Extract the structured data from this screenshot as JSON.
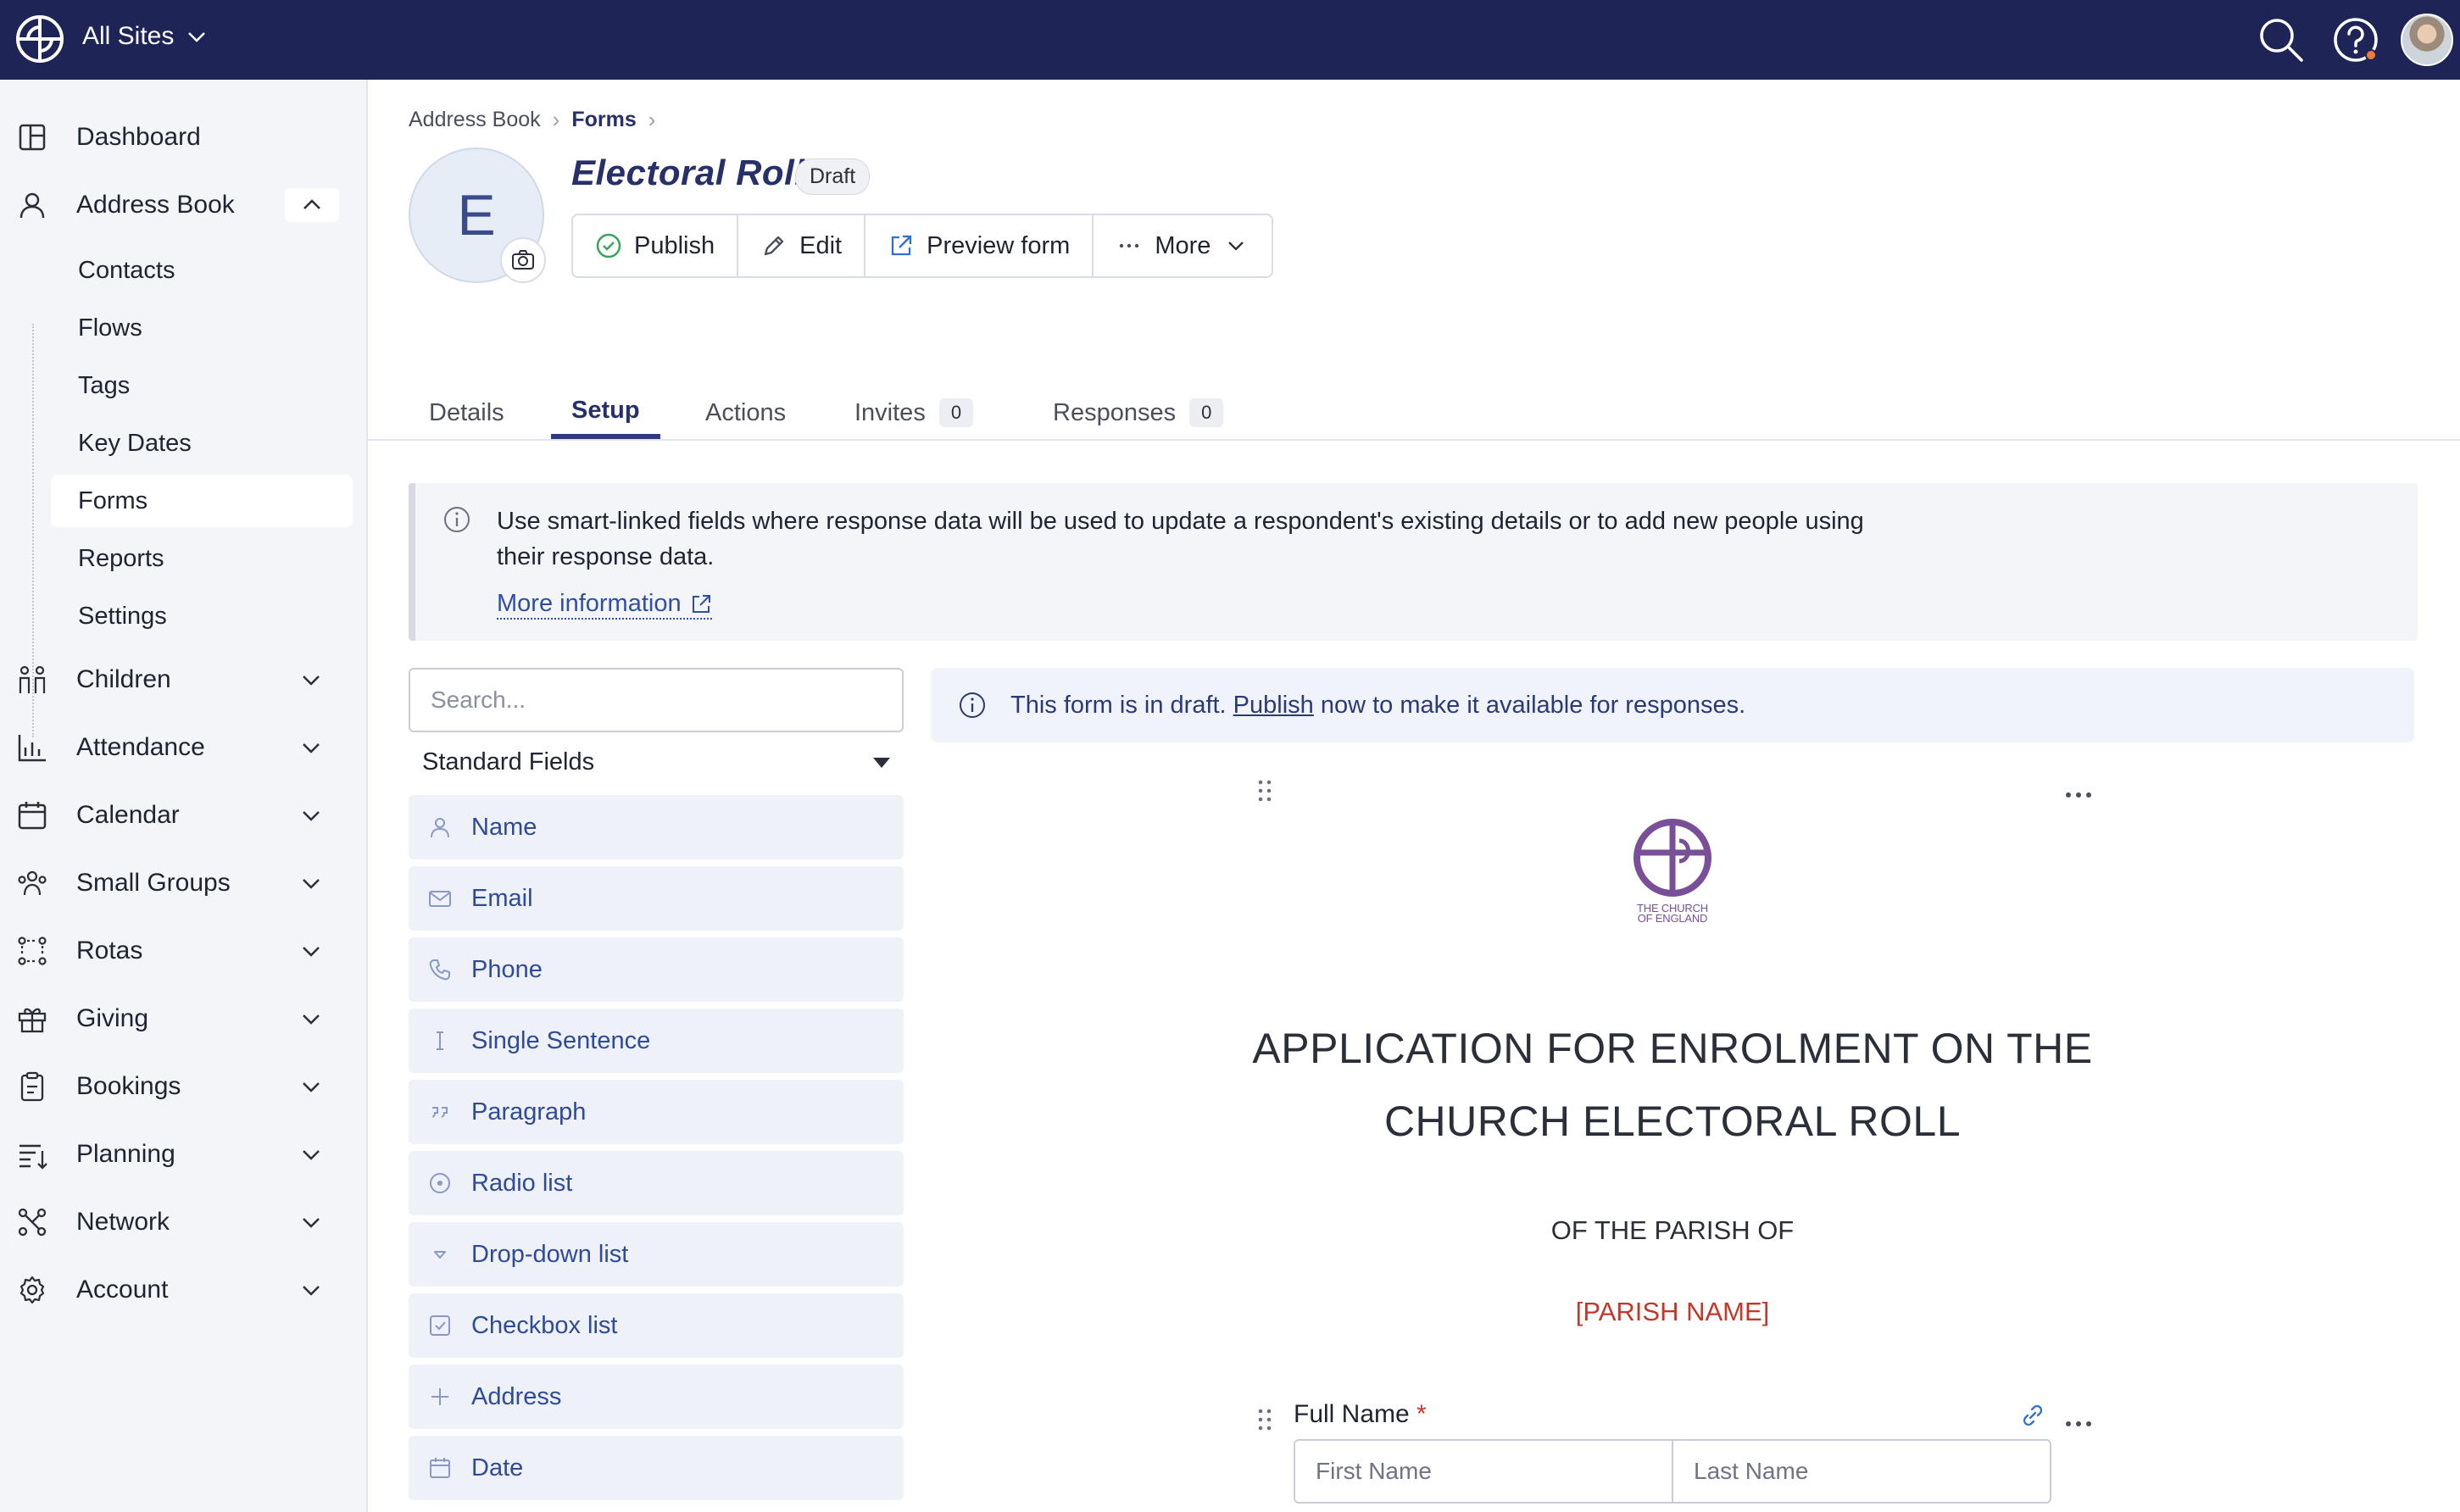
{
  "topbar": {
    "site_label": "All Sites",
    "brand_color": "#1e2456"
  },
  "sidebar": {
    "dashboard": "Dashboard",
    "address_book": "Address Book",
    "sub_items": [
      "Contacts",
      "Flows",
      "Tags",
      "Key Dates",
      "Forms",
      "Reports",
      "Settings"
    ],
    "active_sub_item": "Forms",
    "groups": [
      "Children",
      "Attendance",
      "Calendar",
      "Small Groups",
      "Rotas",
      "Giving",
      "Bookings",
      "Planning",
      "Network",
      "Account"
    ]
  },
  "breadcrumb": {
    "first": "Address Book",
    "second": "Forms"
  },
  "form": {
    "avatar_letter": "E",
    "title": "Electoral Roll",
    "status": "Draft"
  },
  "actions": {
    "publish": "Publish",
    "edit": "Edit",
    "preview": "Preview form",
    "more": "More"
  },
  "tabs": {
    "details": "Details",
    "setup": "Setup",
    "actions": "Actions",
    "invites": "Invites",
    "invites_count": "0",
    "responses": "Responses",
    "responses_count": "0",
    "active": "Setup"
  },
  "info": {
    "text": "Use smart-linked fields where response data will be used to update a respondent's existing details or to add new people using their response data.",
    "link": "More information"
  },
  "palette": {
    "search_placeholder": "Search...",
    "category": "Standard Fields",
    "fields": [
      "Name",
      "Email",
      "Phone",
      "Single Sentence",
      "Paragraph",
      "Radio list",
      "Drop-down list",
      "Checkbox list",
      "Address",
      "Date"
    ]
  },
  "preview": {
    "draft_note_before": "This form is in draft. ",
    "draft_note_link": "Publish",
    "draft_note_after": " now to make it available for responses.",
    "logo_line1": "THE CHURCH",
    "logo_line2": "OF ENGLAND",
    "heading_line1": "APPLICATION FOR ENROLMENT ON THE",
    "heading_line2": "CHURCH ELECTORAL ROLL",
    "sub_heading": "OF THE PARISH OF",
    "parish_placeholder": "[PARISH NAME]",
    "parish_color": "#c0392b",
    "field_label": "Full Name",
    "required_mark": "*",
    "first_name_placeholder": "First Name",
    "last_name_placeholder": "Last Name"
  }
}
